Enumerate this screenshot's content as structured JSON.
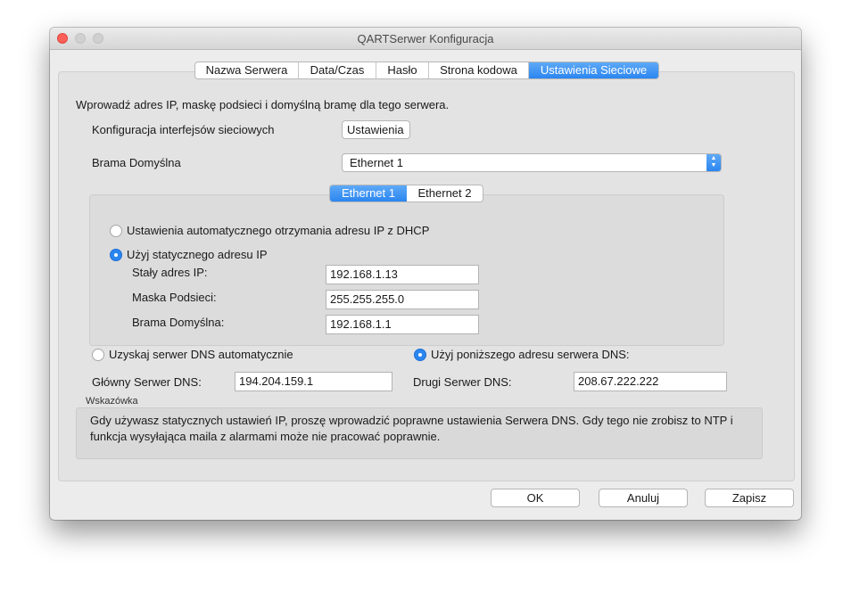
{
  "window": {
    "title": "QARTSerwer Konfiguracja"
  },
  "tabs": [
    {
      "label": "Nazwa Serwera"
    },
    {
      "label": "Data/Czas"
    },
    {
      "label": "Hasło"
    },
    {
      "label": "Strona kodowa"
    },
    {
      "label": "Ustawienia Sieciowe",
      "active": true
    }
  ],
  "network": {
    "intro": "Wprowadź adres IP, maskę podsieci i domyślną bramę dla tego serwera.",
    "interfaces_label": "Konfiguracja interfejsów sieciowych",
    "interfaces_button": "Ustawienia",
    "gateway_label": "Brama Domyślna",
    "gateway_selected": "Ethernet 1"
  },
  "iface_tabs": [
    {
      "label": "Ethernet 1",
      "active": true
    },
    {
      "label": "Ethernet 2"
    }
  ],
  "ip": {
    "dhcp_label": "Ustawienia automatycznego otrzymania adresu IP z DHCP",
    "static_label": "Użyj statycznego adresu IP",
    "mode": "static",
    "address_label": "Stały adres IP:",
    "address_value": "192.168.1.13",
    "mask_label": "Maska Podsieci:",
    "mask_value": "255.255.255.0",
    "gateway_label": "Brama Domyślna:",
    "gateway_value": "192.168.1.1"
  },
  "dns": {
    "auto_label": "Uzyskaj serwer DNS automatycznie",
    "manual_label": "Użyj poniższego adresu serwera DNS:",
    "mode": "manual",
    "primary_label": "Główny Serwer DNS:",
    "primary_value": "194.204.159.1",
    "secondary_label": "Drugi Serwer DNS:",
    "secondary_value": "208.67.222.222"
  },
  "hint": {
    "title": "Wskazówka",
    "text": "Gdy używasz statycznych ustawień IP, proszę wprowadzić poprawne ustawienia Serwera DNS. Gdy tego nie zrobisz to NTP i funkcja wysyłająca maila z alarmami może nie pracować poprawnie."
  },
  "buttons": {
    "ok": "OK",
    "cancel": "Anuluj",
    "save": "Zapisz"
  },
  "colors": {
    "accent": "#2b86f0",
    "close": "#fc5f57"
  }
}
